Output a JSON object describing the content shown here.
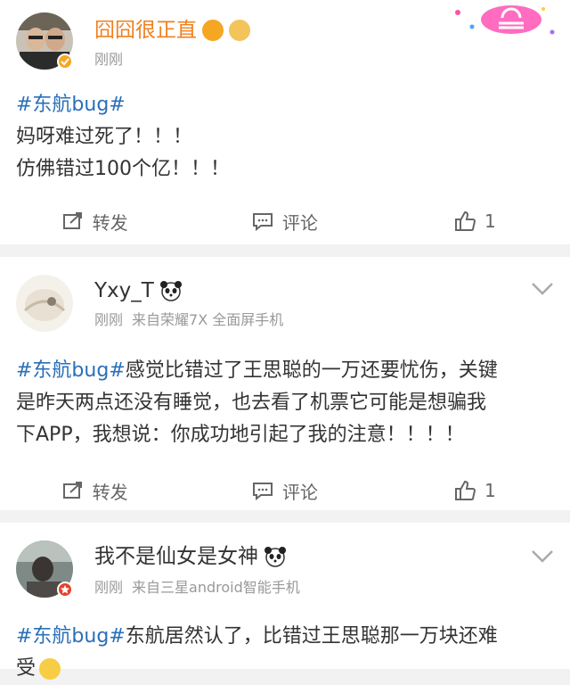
{
  "posts": [
    {
      "username": "囧囧很正直",
      "meta": "刚刚",
      "source": "",
      "body_hashtag": "#东航bug#",
      "body_lines": [
        "妈呀难过死了！！！",
        "仿佛错过100个亿！！！"
      ],
      "actions": {
        "repost": "转发",
        "comment": "评论",
        "like_count": "1"
      }
    },
    {
      "username": "Yxy_T",
      "meta": "刚刚",
      "source": "来自荣耀7X 全面屏手机",
      "body_hashtag": "#东航bug#",
      "body_lines": [
        "感觉比错过了王思聪的一万还要忧伤，关键",
        "是昨天两点还没有睡觉，也去看了机票它可能是想骗我",
        "下APP，我想说：你成功地引起了我的注意！！！！"
      ],
      "actions": {
        "repost": "转发",
        "comment": "评论",
        "like_count": "1"
      }
    },
    {
      "username": "我不是仙女是女神",
      "meta": "刚刚",
      "source": "来自三星android智能手机",
      "body_hashtag": "#东航bug#",
      "body_lines": [
        "东航居然认了，比错过王思聪那一万块还难",
        "受"
      ],
      "actions": {}
    }
  ],
  "colors": {
    "hashtag": "#2a6fb9",
    "vip_name": "#f0801f",
    "meta": "#999999"
  }
}
